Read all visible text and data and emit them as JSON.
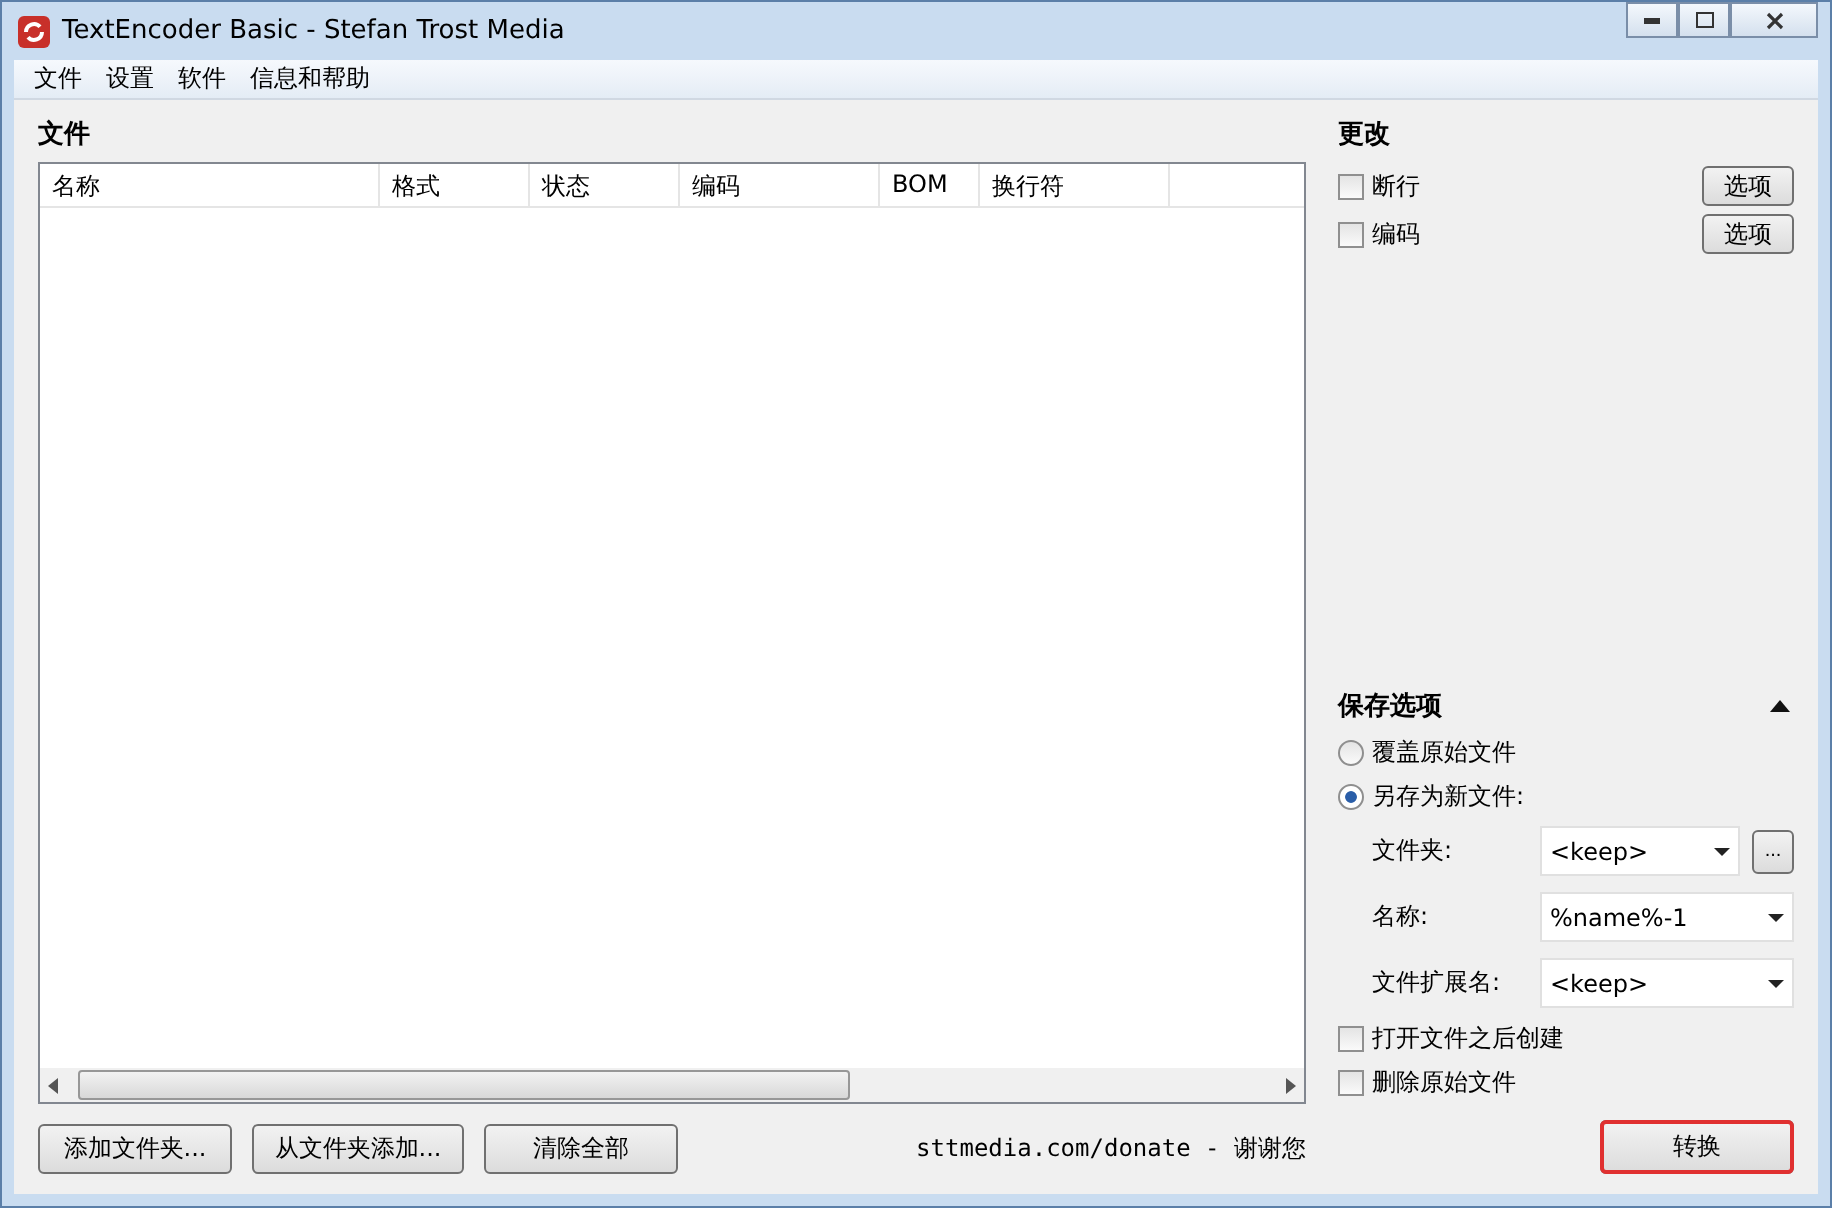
{
  "window": {
    "title": "TextEncoder Basic - Stefan Trost Media"
  },
  "menu": [
    "文件",
    "设置",
    "软件",
    "信息和帮助"
  ],
  "files": {
    "heading": "文件",
    "columns": [
      {
        "label": "名称"
      },
      {
        "label": "格式"
      },
      {
        "label": "状态"
      },
      {
        "label": "编码"
      },
      {
        "label": "BOM"
      },
      {
        "label": "换行符"
      }
    ]
  },
  "change": {
    "heading": "更改",
    "options": [
      {
        "label": "断行",
        "checked": false,
        "button": "选项"
      },
      {
        "label": "编码",
        "checked": false,
        "button": "选项"
      }
    ]
  },
  "save": {
    "heading": "保存选项",
    "expanded": true,
    "modes": [
      {
        "label": "覆盖原始文件",
        "selected": false
      },
      {
        "label": "另存为新文件:",
        "selected": true
      }
    ],
    "fields": [
      {
        "label": "文件夹:",
        "value": "<keep>",
        "browse": "..."
      },
      {
        "label": "名称:",
        "value": "%name%-1"
      },
      {
        "label": "文件扩展名:",
        "value": "<keep>"
      }
    ],
    "checks": [
      {
        "label": "打开文件之后创建",
        "checked": false
      },
      {
        "label": "删除原始文件",
        "checked": false
      }
    ]
  },
  "buttons": [
    "添加文件夹...",
    "从文件夹添加...",
    "清除全部"
  ],
  "donate": "sttmedia.com/donate - 谢谢您",
  "convert": {
    "label": "转换",
    "highlighted": true
  }
}
